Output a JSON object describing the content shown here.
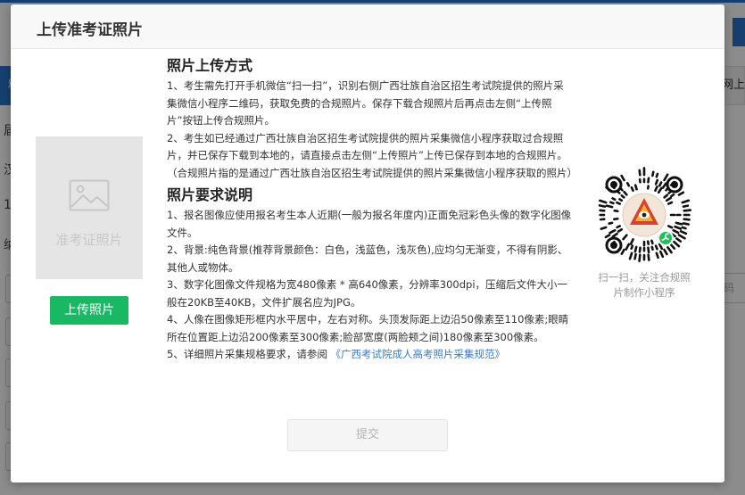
{
  "background": {
    "left_tab_label": "料",
    "right_tab_label": "网上",
    "left_lines": [
      "届",
      "汉",
      "1",
      "纳"
    ],
    "right_input_placeholder": "码"
  },
  "modal": {
    "title": "上传准考证照片",
    "photo_placeholder": "准考证照片",
    "upload_button": "上传照片",
    "submit_button": "提交"
  },
  "method": {
    "title": "照片上传方式",
    "p1": "1、考生需先打开手机微信“扫一扫”，识别右侧广西壮族自治区招生考试院提供的照片采集微信小程序二维码，获取免费的合规照片。保存下载合规照片后再点击左侧“上传照片”按钮上传合规照片。",
    "p2": "2、考生如已经通过广西壮族自治区招生考试院提供的照片采集微信小程序获取过合规照片，并已保存下载到本地的，请直接点击左侧“上传照片”上传已保存到本地的合规照片。（合规照片指的是通过广西壮族自治区招生考试院提供的照片采集微信小程序获取的照片）"
  },
  "requirements": {
    "title": "照片要求说明",
    "p1": "1、报名图像应使用报名考生本人近期(一般为报名年度内)正面免冠彩色头像的数字化图像文件。",
    "p2": "2、背景:纯色背景(推荐背景颜色：白色，浅蓝色，浅灰色),应均匀无渐变，不得有阴影、其他人或物体。",
    "p3": "3、数字化图像文件规格为宽480像素 * 高640像素，分辨率300dpi，压缩后文件大小一般在20KB至40KB，文件扩展名应为JPG。",
    "p4": "4、人像在图像矩形框内水平居中，左右对称。头顶发际距上边沿50像素至110像素;眼睛所在位置距上边沿200像素至300像素;脸部宽度(两脸颊之间)180像素至300像素。",
    "p5_prefix": "5、详细照片采集规格要求，请参阅",
    "p5_link": "《广西考试院成人高考照片采集规范》"
  },
  "qr": {
    "caption": "扫一扫，关注合规照片制作小程序"
  },
  "colors": {
    "primary_blue": "#2b74c8",
    "upload_green": "#19b864",
    "link_blue": "#3a7bc8"
  }
}
